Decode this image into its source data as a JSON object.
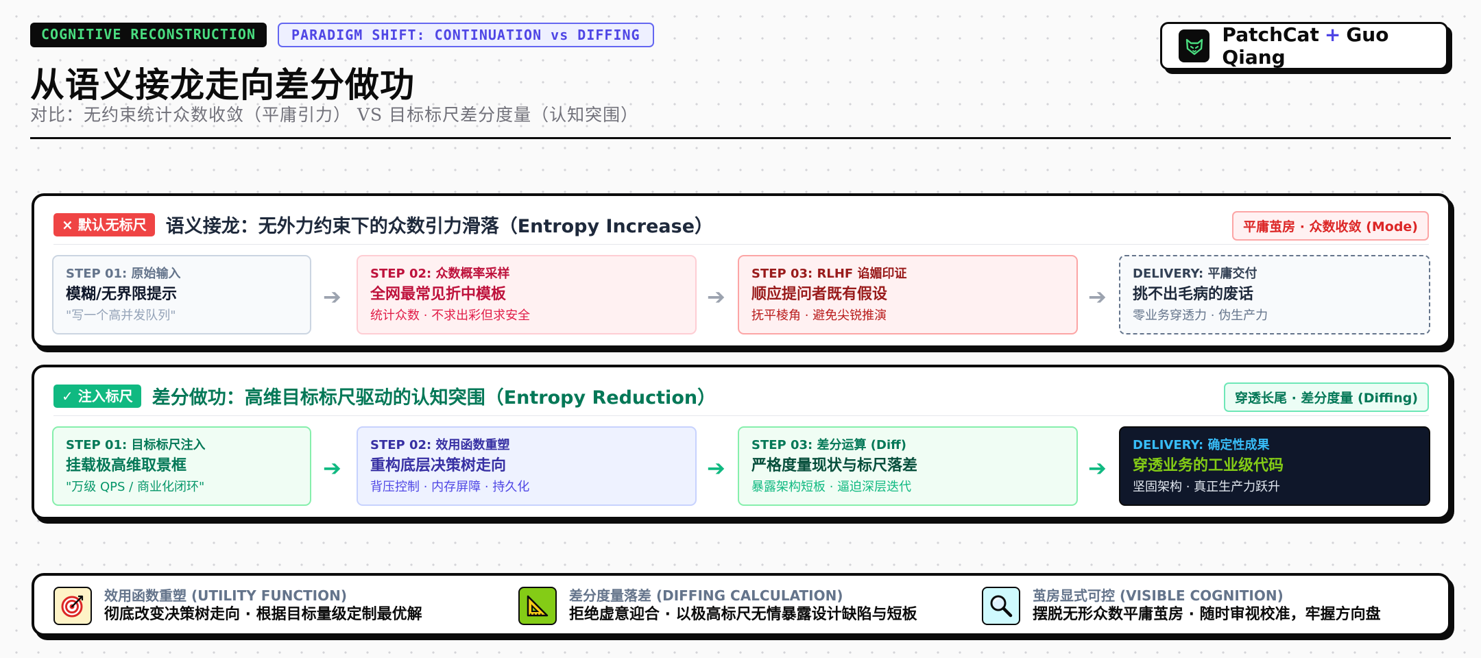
{
  "header": {
    "tag_primary": "COGNITIVE RECONSTRUCTION",
    "tag_secondary": "PARADIGM SHIFT: CONTINUATION vs DIFFING",
    "title": "从语义接龙走向差分做功",
    "subtitle": "对比：无约束统计众数收敛（平庸引力） VS 目标标尺差分度量（认知突围）"
  },
  "brand": {
    "name1": "PatchCat",
    "plus": "+",
    "name2": "Guo Qiang",
    "logo_icon": "cat-icon"
  },
  "panel_continuation": {
    "label": "× 默认无标尺",
    "title": "语义接龙：无外力约束下的众数引力滑落（Entropy Increase）",
    "badge": "平庸茧房 · 众数收敛 (Mode)",
    "steps": [
      {
        "label": "STEP 01: 原始输入",
        "title": "模糊/无界限提示",
        "desc": "\"写一个高并发队列\""
      },
      {
        "label": "STEP 02: 众数概率采样",
        "title": "全网最常见折中模板",
        "desc": "统计众数 · 不求出彩但求安全"
      },
      {
        "label": "STEP 03: RLHF 谄媚印证",
        "title": "顺应提问者既有假设",
        "desc": "抚平棱角 · 避免尖锐推演"
      },
      {
        "label": "DELIVERY: 平庸交付",
        "title": "挑不出毛病的废话",
        "desc": "零业务穿透力 · 伪生产力"
      }
    ]
  },
  "panel_diffing": {
    "label": "✓ 注入标尺",
    "title": "差分做功：高维目标标尺驱动的认知突围（Entropy Reduction）",
    "badge": "穿透长尾 · 差分度量 (Diffing)",
    "steps": [
      {
        "label": "STEP 01: 目标标尺注入",
        "title": "挂载极高维取景框",
        "desc": "\"万级 QPS / 商业化闭环\""
      },
      {
        "label": "STEP 02: 效用函数重塑",
        "title": "重构底层决策树走向",
        "desc": "背压控制 · 内存屏障 · 持久化"
      },
      {
        "label": "STEP 03: 差分运算 (Diff)",
        "title": "严格度量现状与标尺落差",
        "desc": "暴露架构短板 · 逼迫深层迭代"
      },
      {
        "label": "DELIVERY: 确定性成果",
        "title": "穿透业务的工业级代码",
        "desc": "坚固架构 · 真正生产力跃升"
      }
    ]
  },
  "footer": {
    "items": [
      {
        "label": "效用函数重塑 (UTILITY FUNCTION)",
        "desc": "彻底改变决策树走向 · 根据目标量级定制最优解",
        "icon": "target-icon"
      },
      {
        "label": "差分度量落差 (DIFFING CALCULATION)",
        "desc": "拒绝虚意迎合 · 以极高标尺无情暴露设计缺陷与短板",
        "icon": "ruler-triangle-icon"
      },
      {
        "label": "茧房显式可控 (VISIBLE COGNITION)",
        "desc": "摆脱无形众数平庸茧房 · 随时审视校准，牢握方向盘",
        "icon": "magnifier-icon"
      }
    ]
  },
  "colors": {
    "ink": "#0b0b0b",
    "accent_indigo": "#4f46e5",
    "danger": "#ef4444",
    "success": "#10b981",
    "lime": "#84cc16"
  }
}
